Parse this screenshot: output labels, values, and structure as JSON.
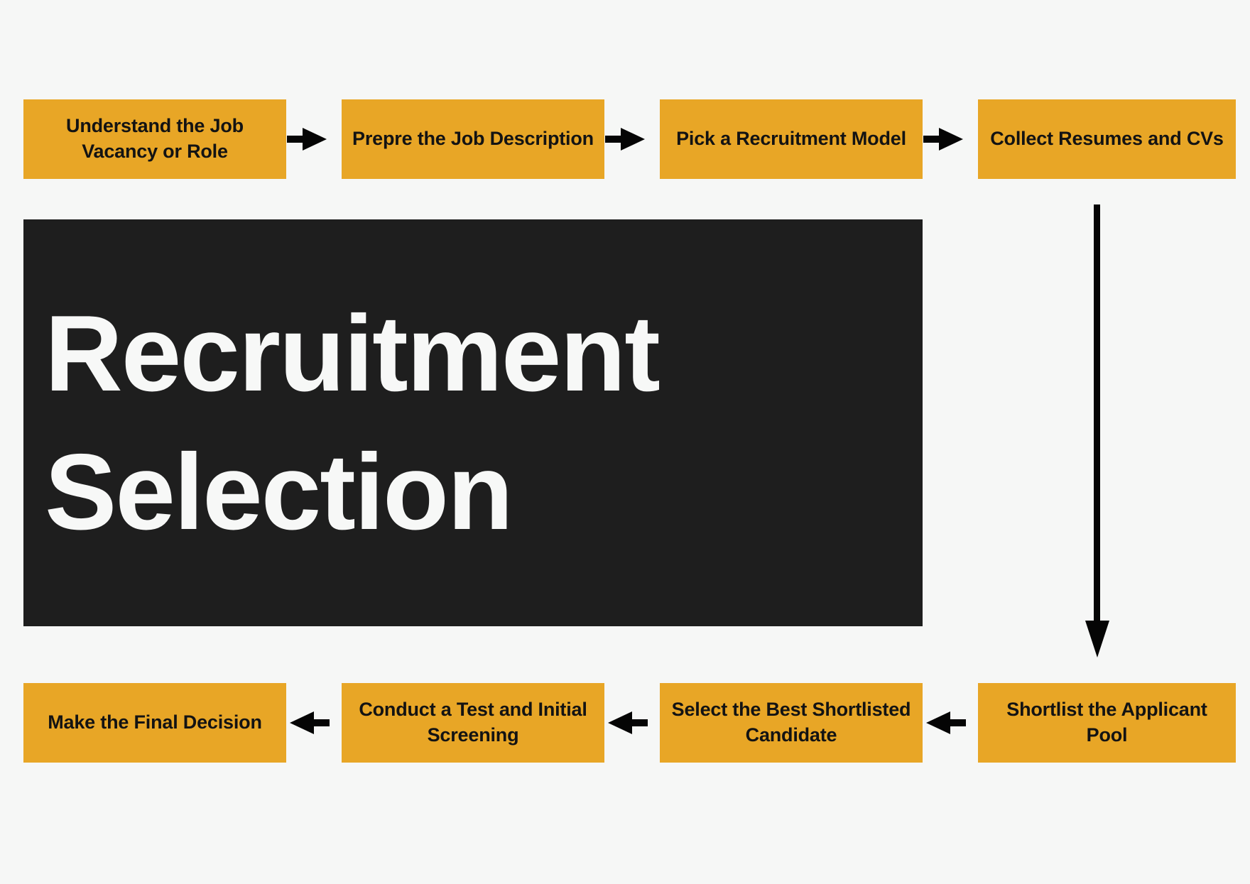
{
  "title": {
    "line1": "Recruitment",
    "line2": "Selection"
  },
  "colors": {
    "background": "#f6f7f6",
    "node_fill": "#e8a626",
    "node_text": "#131313",
    "panel_fill": "#1e1e1e",
    "panel_text": "#f7f8f7",
    "arrow": "#050505"
  },
  "process": {
    "top_row": [
      {
        "label": "Understand the Job Vacancy or Role"
      },
      {
        "label": "Prepre the Job Description"
      },
      {
        "label": "Pick a Recruitment Model"
      },
      {
        "label": "Collect Resumes and CVs"
      }
    ],
    "bottom_row": [
      {
        "label": "Shortlist the Applicant Pool"
      },
      {
        "label": "Select the Best Shortlisted Candidate"
      },
      {
        "label": "Conduct a Test and Initial Screening"
      },
      {
        "label": "Make the Final Decision"
      }
    ]
  },
  "connectors": {
    "top": [
      {
        "name": "arrow-right-icon",
        "direction": "right"
      },
      {
        "name": "arrow-right-icon",
        "direction": "right"
      },
      {
        "name": "arrow-right-icon",
        "direction": "right"
      }
    ],
    "vertical": {
      "name": "arrow-down-icon",
      "direction": "down"
    },
    "bottom": [
      {
        "name": "arrow-left-icon",
        "direction": "left"
      },
      {
        "name": "arrow-left-icon",
        "direction": "left"
      },
      {
        "name": "arrow-left-icon",
        "direction": "left"
      }
    ]
  }
}
